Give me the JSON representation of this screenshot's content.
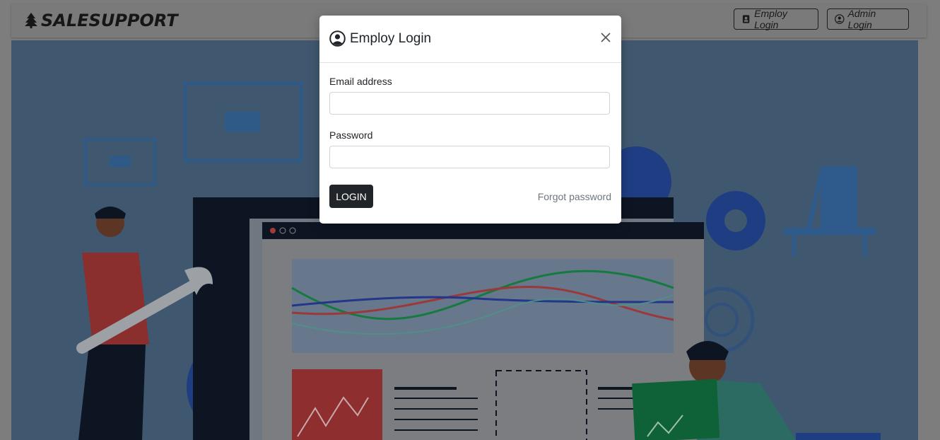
{
  "navbar": {
    "brand": "SALESUPPORT",
    "brand_icon": "tree-icon",
    "employ_login_label": "Employ Login",
    "admin_login_label": "Admin Login"
  },
  "modal": {
    "title": "Employ Login",
    "email_label": "Email address",
    "email_value": "",
    "password_label": "Password",
    "password_value": "",
    "login_button": "LOGIN",
    "forgot_password": "Forgot password"
  },
  "colors": {
    "overlay_bg": "#7d7d7d",
    "hero_bg": "#40586f",
    "accent_dark": "#212529"
  }
}
